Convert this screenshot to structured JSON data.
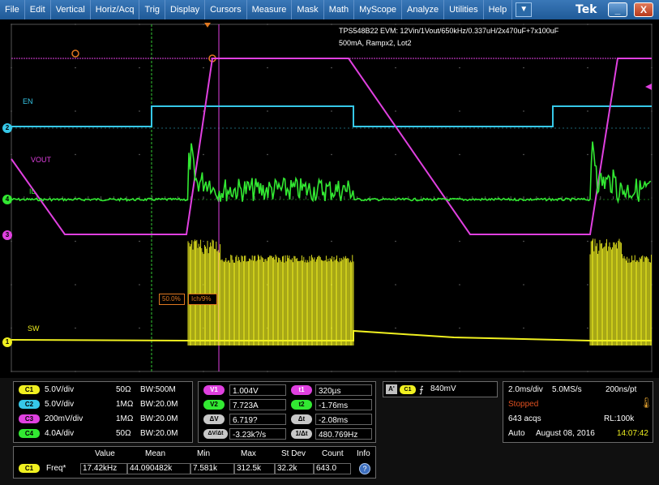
{
  "menu": [
    "File",
    "Edit",
    "Vertical",
    "Horiz/Acq",
    "Trig",
    "Display",
    "Cursors",
    "Measure",
    "Mask",
    "Math",
    "MyScope",
    "Analyze",
    "Utilities",
    "Help"
  ],
  "brand": "Tek",
  "window": {
    "minimize": "_",
    "close": "X"
  },
  "scope": {
    "title_line1": "TPS548B22 EVM: 12Vin/1Vout/650kHz/0.337uH/2x470uF+7x100uF",
    "title_line2": "500mA, Rampx2, Lot2",
    "labels": {
      "en": "EN",
      "vout": "VOUT",
      "il": "IL",
      "sw": "SW"
    },
    "markers": {
      "ch1": "1",
      "ch2": "2",
      "ch3": "3",
      "ch4": "4"
    },
    "cursor_a_label": "50.0%",
    "cursor_b_label": "Ich/9%"
  },
  "channels": [
    {
      "badge": "C1",
      "scale": "5.0V/div",
      "imp": "50Ω",
      "bw": "BW:500M",
      "color": "#f0f020"
    },
    {
      "badge": "C2",
      "scale": "5.0V/div",
      "imp": "1MΩ",
      "bw": "BW:20.0M",
      "color": "#36c8e8"
    },
    {
      "badge": "C3",
      "scale": "200mV/div",
      "imp": "1MΩ",
      "bw": "BW:20.0M",
      "color": "#e040e0"
    },
    {
      "badge": "C4",
      "scale": "4.0A/div",
      "imp": "50Ω",
      "bw": "BW:20.0M",
      "color": "#32e832"
    }
  ],
  "cursors": {
    "v1_tag": "V1",
    "v1": "1.004V",
    "v2_tag": "V2",
    "v2": "7.723A",
    "dv_tag": "ΔV",
    "dv": "6.719?",
    "dvdt_tag": "ΔV/Δt",
    "dvdt": "-3.23k?/s",
    "t1_tag": "t1",
    "t1": "320µs",
    "t2_tag": "t2",
    "t2": "-1.76ms",
    "dt_tag": "Δt",
    "dt": "-2.08ms",
    "inv_tag": "1/Δt",
    "inv": "480.769Hz"
  },
  "trigger": {
    "source": "A'",
    "channel": "C1",
    "slope": "⨍",
    "level": "840mV"
  },
  "acquisition": {
    "timebase": "2.0ms/div",
    "rate": "5.0MS/s",
    "resolution": "200ns/pt",
    "state": "Stopped",
    "acqs": "643 acqs",
    "record": "RL:100k",
    "mode": "Auto",
    "date": "August 08, 2016",
    "time": "14:07:42"
  },
  "measurement": {
    "headers": [
      "Value",
      "Mean",
      "Min",
      "Max",
      "St Dev",
      "Count",
      "Info"
    ],
    "channel": "C1",
    "name": "Freq*",
    "values": [
      "17.42kHz",
      "44.090482k",
      "7.581k",
      "312.5k",
      "32.2k",
      "643.0"
    ]
  },
  "colors": {
    "ch1": "#f0f020",
    "ch2": "#36c8e8",
    "ch3": "#e040e0",
    "ch4": "#32e832",
    "cursor": "#e07820"
  }
}
